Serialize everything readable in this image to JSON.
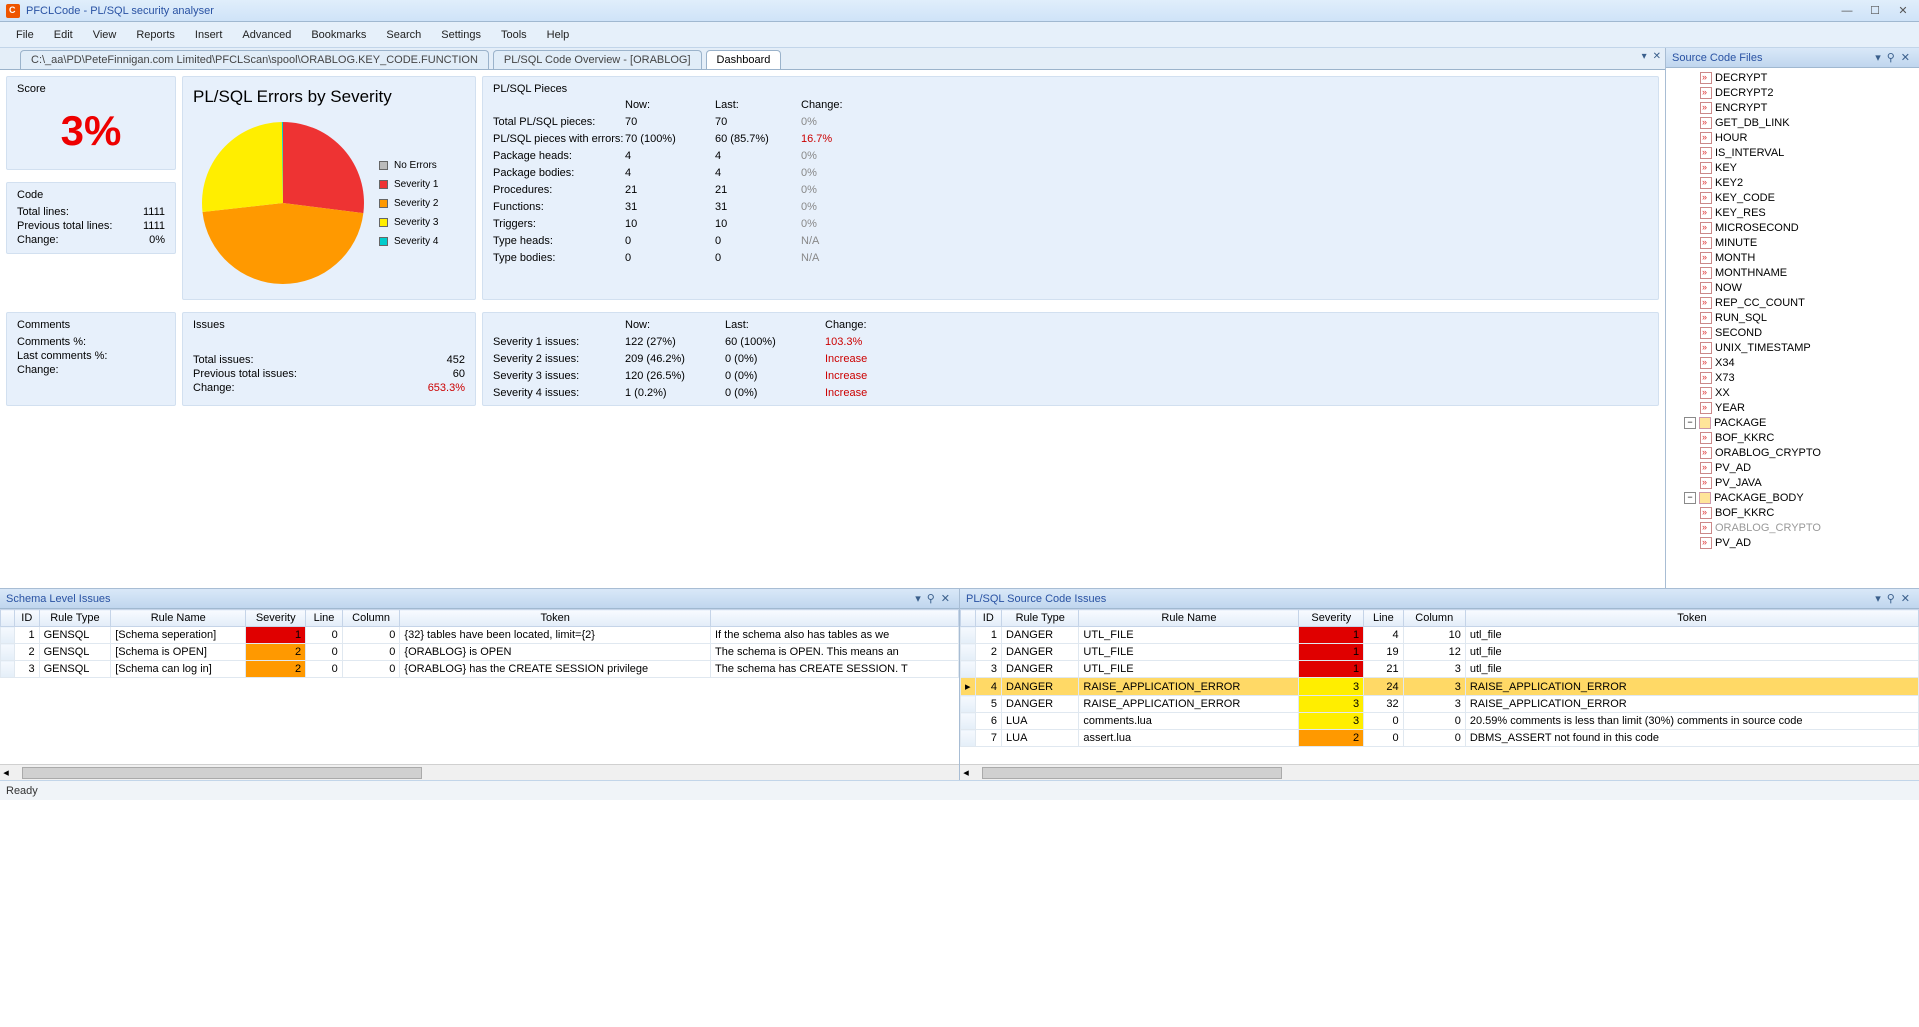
{
  "window": {
    "title": "PFCLCode - PL/SQL security analyser"
  },
  "menu": [
    "File",
    "Edit",
    "View",
    "Reports",
    "Insert",
    "Advanced",
    "Bookmarks",
    "Search",
    "Settings",
    "Tools",
    "Help"
  ],
  "tabs": [
    {
      "label": "C:\\_aa\\PD\\PeteFinnigan.com Limited\\PFCLScan\\spool\\ORABLOG.KEY_CODE.FUNCTION",
      "active": false
    },
    {
      "label": "PL/SQL Code Overview - [ORABLOG]",
      "active": false
    },
    {
      "label": "Dashboard",
      "active": true
    }
  ],
  "dash": {
    "score_title": "Score",
    "score": "3%",
    "code_title": "Code",
    "code": {
      "total_lines_lbl": "Total lines:",
      "total_lines": "1111",
      "prev_lbl": "Previous total lines:",
      "prev": "1111",
      "change_lbl": "Change:",
      "change": "0%"
    },
    "comments_title": "Comments",
    "comments": {
      "pct_lbl": "Comments %:",
      "lastpct_lbl": "Last comments %:",
      "change_lbl": "Change:"
    },
    "chart_title": "PL/SQL Errors by Severity",
    "legend": [
      "No Errors",
      "Severity 1",
      "Severity 2",
      "Severity 3",
      "Severity 4"
    ],
    "legend_colors": [
      "#bbbbbb",
      "#ee3333",
      "#ff9900",
      "#ffee00",
      "#00cccc"
    ],
    "pieces_title": "PL/SQL Pieces",
    "pieces_cols": [
      "",
      "Now:",
      "Last:",
      "Change:"
    ],
    "pieces_rows": [
      [
        "Total PL/SQL pieces:",
        "70",
        "70",
        "0%"
      ],
      [
        "PL/SQL pieces with errors:",
        "70 (100%)",
        "60 (85.7%)",
        "16.7%"
      ],
      [
        "Package heads:",
        "4",
        "4",
        "0%"
      ],
      [
        "Package bodies:",
        "4",
        "4",
        "0%"
      ],
      [
        "Procedures:",
        "21",
        "21",
        "0%"
      ],
      [
        "Functions:",
        "31",
        "31",
        "0%"
      ],
      [
        "Triggers:",
        "10",
        "10",
        "0%"
      ],
      [
        "Type heads:",
        "0",
        "0",
        "N/A"
      ],
      [
        "Type bodies:",
        "0",
        "0",
        "N/A"
      ]
    ],
    "issues_title": "Issues",
    "issues": {
      "total_lbl": "Total issues:",
      "total": "452",
      "prev_lbl": "Previous total issues:",
      "prev": "60",
      "change_lbl": "Change:",
      "change": "653.3%"
    },
    "sev_cols": [
      "",
      "Now:",
      "Last:",
      "Change:"
    ],
    "sev_rows": [
      [
        "Severity 1 issues:",
        "122 (27%)",
        "60 (100%)",
        "103.3%"
      ],
      [
        "Severity 2 issues:",
        "209 (46.2%)",
        "0 (0%)",
        "Increase"
      ],
      [
        "Severity 3 issues:",
        "120 (26.5%)",
        "0 (0%)",
        "Increase"
      ],
      [
        "Severity 4 issues:",
        "1 (0.2%)",
        "0 (0%)",
        "Increase"
      ]
    ]
  },
  "chart_data": {
    "type": "pie",
    "title": "PL/SQL Errors by Severity",
    "series": [
      {
        "name": "No Errors",
        "value": 0,
        "color": "#bbbbbb"
      },
      {
        "name": "Severity 1",
        "value": 122,
        "color": "#ee3333"
      },
      {
        "name": "Severity 2",
        "value": 209,
        "color": "#ff9900"
      },
      {
        "name": "Severity 3",
        "value": 120,
        "color": "#ffee00"
      },
      {
        "name": "Severity 4",
        "value": 1,
        "color": "#00cccc"
      }
    ]
  },
  "source_tree": {
    "title": "Source Code Files",
    "functions": [
      "DECRYPT",
      "DECRYPT2",
      "ENCRYPT",
      "GET_DB_LINK",
      "HOUR",
      "IS_INTERVAL",
      "KEY",
      "KEY2",
      "KEY_CODE",
      "KEY_RES",
      "MICROSECOND",
      "MINUTE",
      "MONTH",
      "MONTHNAME",
      "NOW",
      "REP_CC_COUNT",
      "RUN_SQL",
      "SECOND",
      "UNIX_TIMESTAMP",
      "X34",
      "X73",
      "XX",
      "YEAR"
    ],
    "package_lbl": "PACKAGE",
    "packages": [
      "BOF_KKRC",
      "ORABLOG_CRYPTO",
      "PV_AD",
      "PV_JAVA"
    ],
    "package_body_lbl": "PACKAGE_BODY",
    "package_bodies": [
      "BOF_KKRC",
      "ORABLOG_CRYPTO",
      "PV_AD"
    ],
    "dim_item": "ORABLOG_CRYPTO"
  },
  "schema_issues": {
    "title": "Schema Level Issues",
    "cols": [
      "ID",
      "Rule Type",
      "Rule Name",
      "Severity",
      "Line",
      "Column",
      "Token",
      ""
    ],
    "rows": [
      {
        "id": "1",
        "type": "GENSQL",
        "name": "[Schema seperation]",
        "sev": "1",
        "line": "0",
        "col": "0",
        "token": "{32} tables have been located, limit={2}",
        "extra": "If the schema also has tables as we"
      },
      {
        "id": "2",
        "type": "GENSQL",
        "name": "[Schema is OPEN]",
        "sev": "2",
        "line": "0",
        "col": "0",
        "token": "{ORABLOG} is OPEN",
        "extra": "The schema is OPEN. This means an"
      },
      {
        "id": "3",
        "type": "GENSQL",
        "name": "[Schema can log in]",
        "sev": "2",
        "line": "0",
        "col": "0",
        "token": "{ORABLOG} has the CREATE SESSION privilege",
        "extra": "The schema has CREATE SESSION. T"
      }
    ]
  },
  "code_issues": {
    "title": "PL/SQL Source Code Issues",
    "cols": [
      "ID",
      "Rule Type",
      "Rule Name",
      "Severity",
      "Line",
      "Column",
      "Token"
    ],
    "rows": [
      {
        "id": "1",
        "type": "DANGER",
        "name": "UTL_FILE",
        "sev": "1",
        "line": "4",
        "col": "10",
        "token": "utl_file"
      },
      {
        "id": "2",
        "type": "DANGER",
        "name": "UTL_FILE",
        "sev": "1",
        "line": "19",
        "col": "12",
        "token": "utl_file"
      },
      {
        "id": "3",
        "type": "DANGER",
        "name": "UTL_FILE",
        "sev": "1",
        "line": "21",
        "col": "3",
        "token": "utl_file"
      },
      {
        "id": "4",
        "type": "DANGER",
        "name": "RAISE_APPLICATION_ERROR",
        "sev": "3",
        "line": "24",
        "col": "3",
        "token": "RAISE_APPLICATION_ERROR",
        "selected": true
      },
      {
        "id": "5",
        "type": "DANGER",
        "name": "RAISE_APPLICATION_ERROR",
        "sev": "3",
        "line": "32",
        "col": "3",
        "token": "RAISE_APPLICATION_ERROR"
      },
      {
        "id": "6",
        "type": "LUA",
        "name": "comments.lua",
        "sev": "3",
        "line": "0",
        "col": "0",
        "token": "20.59% comments is less than limit (30%) comments in source code"
      },
      {
        "id": "7",
        "type": "LUA",
        "name": "assert.lua",
        "sev": "2",
        "line": "0",
        "col": "0",
        "token": "DBMS_ASSERT not found in this code"
      }
    ]
  },
  "status": "Ready"
}
